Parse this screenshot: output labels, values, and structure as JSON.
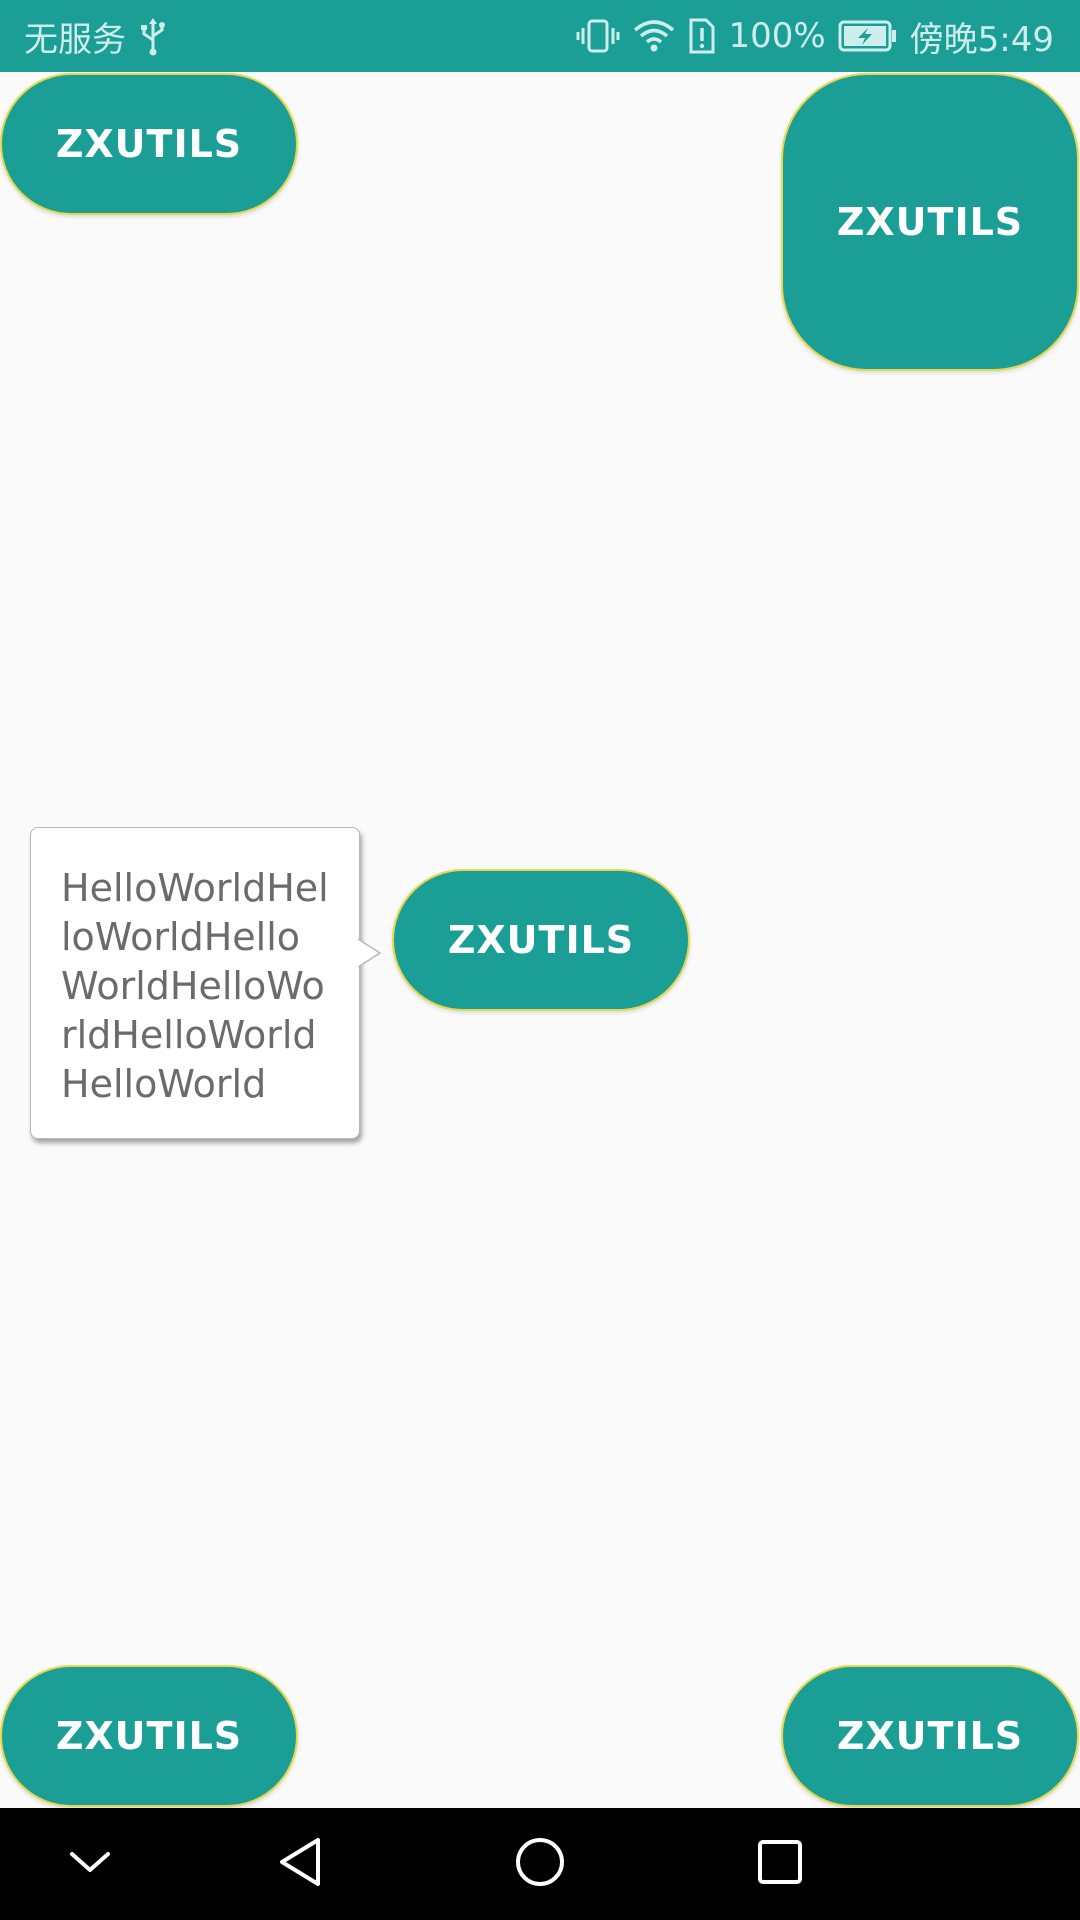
{
  "status_bar": {
    "carrier": "无服务",
    "battery_percent": "100%",
    "time": "傍晚5:49",
    "icons": [
      "usb-icon",
      "vibrate-icon",
      "wifi-icon",
      "sim-alert-icon",
      "battery-charging-icon"
    ]
  },
  "buttons": {
    "top_left": "ZXUTILS",
    "top_right": "ZXUTILS",
    "center": "ZXUTILS",
    "bottom_left": "ZXUTILS",
    "bottom_right": "ZXUTILS"
  },
  "tooltip": {
    "text": "HelloWorldHelloWorldHelloWorldHelloWorldHelloWorldHelloWorld"
  },
  "nav_bar": {
    "icons": [
      "collapse-icon",
      "back-icon",
      "home-icon",
      "recents-icon"
    ]
  },
  "colors": {
    "primary": "#1a9e96",
    "button_border": "#e6d84a",
    "background": "#fafafa",
    "tooltip_text": "#6b6b6b"
  }
}
